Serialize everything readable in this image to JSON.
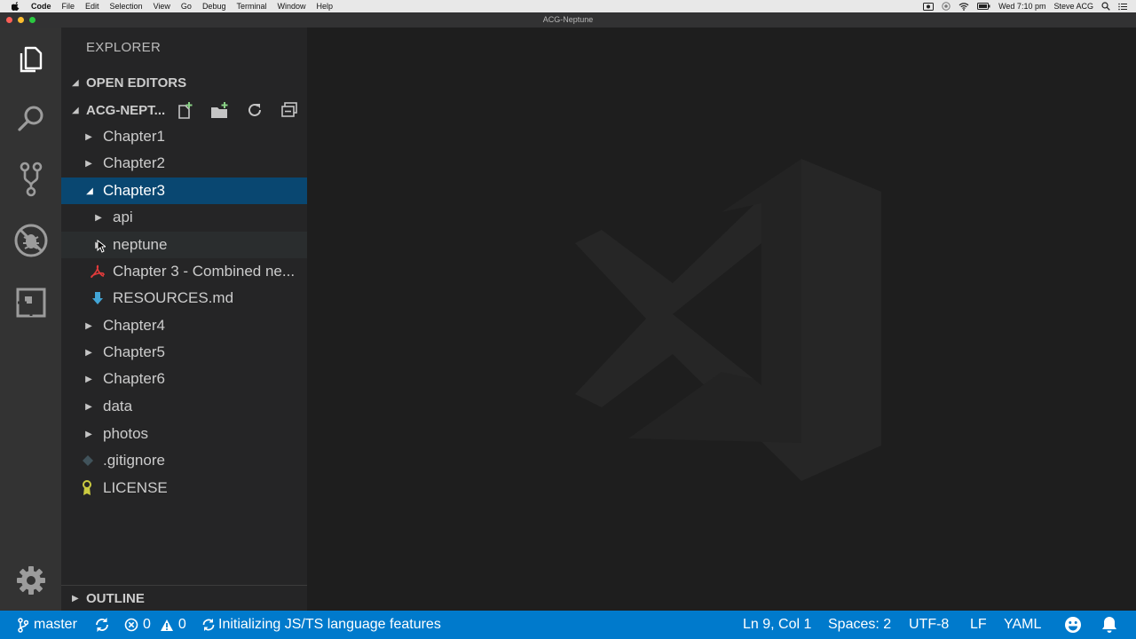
{
  "menubar": {
    "items": [
      "Code",
      "File",
      "Edit",
      "Selection",
      "View",
      "Go",
      "Debug",
      "Terminal",
      "Window",
      "Help"
    ],
    "clock": "Wed 7:10 pm",
    "user": "Steve ACG"
  },
  "window": {
    "title": "ACG-Neptune"
  },
  "sidebar": {
    "title": "EXPLORER",
    "open_editors": "OPEN EDITORS",
    "folder": "ACG-NEPT...",
    "outline": "OUTLINE",
    "tree": [
      {
        "name": "Chapter1"
      },
      {
        "name": "Chapter2"
      },
      {
        "name": "Chapter3"
      },
      {
        "name": "api"
      },
      {
        "name": "neptune"
      },
      {
        "name": "Chapter 3 - Combined ne..."
      },
      {
        "name": "RESOURCES.md"
      },
      {
        "name": "Chapter4"
      },
      {
        "name": "Chapter5"
      },
      {
        "name": "Chapter6"
      },
      {
        "name": "data"
      },
      {
        "name": "photos"
      },
      {
        "name": ".gitignore"
      },
      {
        "name": "LICENSE"
      }
    ]
  },
  "statusbar": {
    "branch": "master",
    "errors": "0",
    "warnings": "0",
    "message": "Initializing JS/TS language features",
    "position": "Ln 9, Col 1",
    "spaces": "Spaces: 2",
    "encoding": "UTF-8",
    "eol": "LF",
    "language": "YAML"
  },
  "colors": {
    "accent": "#007acc",
    "selection": "#094771",
    "activity_bar": "#333333",
    "sidebar": "#252526",
    "editor": "#1e1e1e"
  }
}
